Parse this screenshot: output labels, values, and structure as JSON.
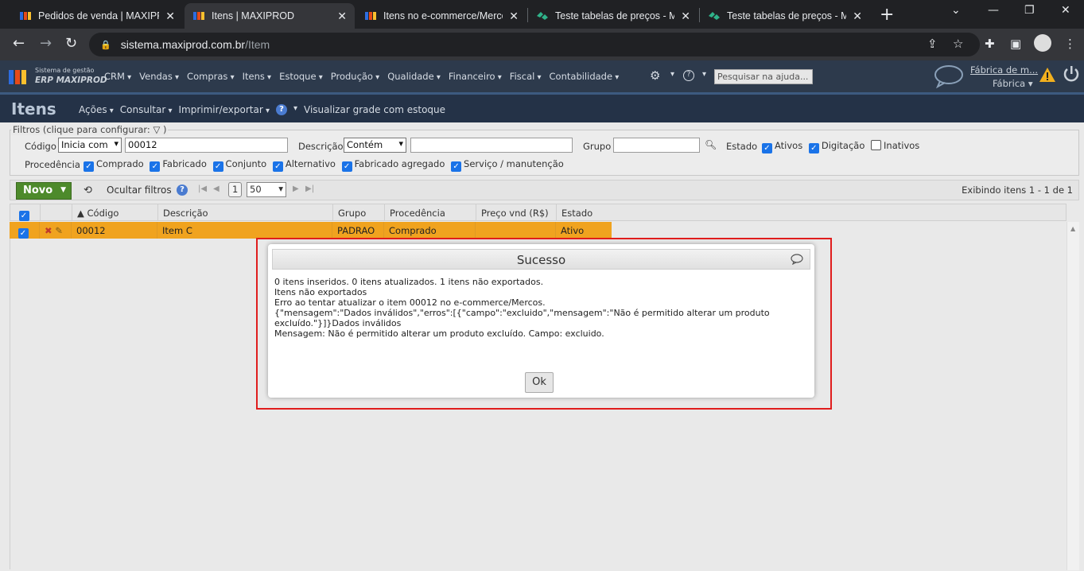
{
  "browser": {
    "tabs": [
      {
        "title": "Pedidos de venda | MAXIPROD",
        "active": false
      },
      {
        "title": "Itens | MAXIPROD",
        "active": true
      },
      {
        "title": "Itens no e-commerce/Mercos",
        "active": false
      },
      {
        "title": "Teste tabelas de preços - MX",
        "active": false
      },
      {
        "title": "Teste tabelas de preços - MX",
        "active": false
      }
    ],
    "url_host": "sistema.maxiprod.com.br",
    "url_path": "/Item"
  },
  "app": {
    "brand_line1": "Sistema de gestão",
    "brand_line2": "ERP MAXIPROD",
    "menu": [
      "CRM",
      "Vendas",
      "Compras",
      "Itens",
      "Estoque",
      "Produção",
      "Qualidade",
      "Financeiro",
      "Fiscal",
      "Contabilidade"
    ],
    "help_search_placeholder": "Pesquisar na ajuda...",
    "company_name": "Fábrica de m...",
    "company_sub": "Fábrica"
  },
  "page": {
    "title": "Itens",
    "actions": [
      "Ações",
      "Consultar",
      "Imprimir/exportar"
    ],
    "grid_view_label": "Visualizar grade com estoque"
  },
  "filters": {
    "legend": "Filtros (clique para configurar:",
    "codigo_label": "Código",
    "codigo_mode": "Inicia com",
    "codigo_value": "00012",
    "descricao_label": "Descrição",
    "descricao_mode": "Contém",
    "descricao_value": "",
    "grupo_label": "Grupo",
    "grupo_value": "",
    "estado_label": "Estado",
    "estado_options": [
      {
        "label": "Ativos",
        "checked": true
      },
      {
        "label": "Digitação",
        "checked": true
      },
      {
        "label": "Inativos",
        "checked": false
      }
    ],
    "procedencia_label": "Procedência",
    "procedencia_options": [
      {
        "label": "Comprado",
        "checked": true
      },
      {
        "label": "Fabricado",
        "checked": true
      },
      {
        "label": "Conjunto",
        "checked": true
      },
      {
        "label": "Alternativo",
        "checked": true
      },
      {
        "label": "Fabricado agregado",
        "checked": true
      },
      {
        "label": "Serviço / manutenção",
        "checked": true
      }
    ]
  },
  "toolbar": {
    "new_label": "Novo",
    "hide_filters_label": "Ocultar filtros",
    "page_number": "1",
    "page_size": "50",
    "showing_label": "Exibindo itens 1 - 1 de 1"
  },
  "grid": {
    "columns": [
      "Código",
      "Descrição",
      "Grupo",
      "Procedência",
      "Preço vnd (R$)",
      "Estado"
    ],
    "rows": [
      {
        "codigo": "00012",
        "descricao": "Item C",
        "grupo": "PADRAO",
        "procedencia": "Comprado",
        "preco": "",
        "estado": "Ativo"
      }
    ],
    "selected_row_color": "#f0a31f"
  },
  "dialog": {
    "title": "Sucesso",
    "lines": [
      "0 itens inseridos. 0 itens atualizados. 1 itens não exportados.",
      "Itens não exportados",
      "Erro ao tentar atualizar o item 00012 no e-commerce/Mercos.",
      "{\"mensagem\":\"Dados inválidos\",\"erros\":[{\"campo\":\"excluido\",\"mensagem\":\"Não é permitido alterar um produto",
      "excluído.\"}]}Dados inválidos",
      "Mensagem: Não é permitido alterar um produto excluído. Campo: excluido."
    ],
    "ok_label": "Ok",
    "highlight_color": "#e01d1d"
  }
}
